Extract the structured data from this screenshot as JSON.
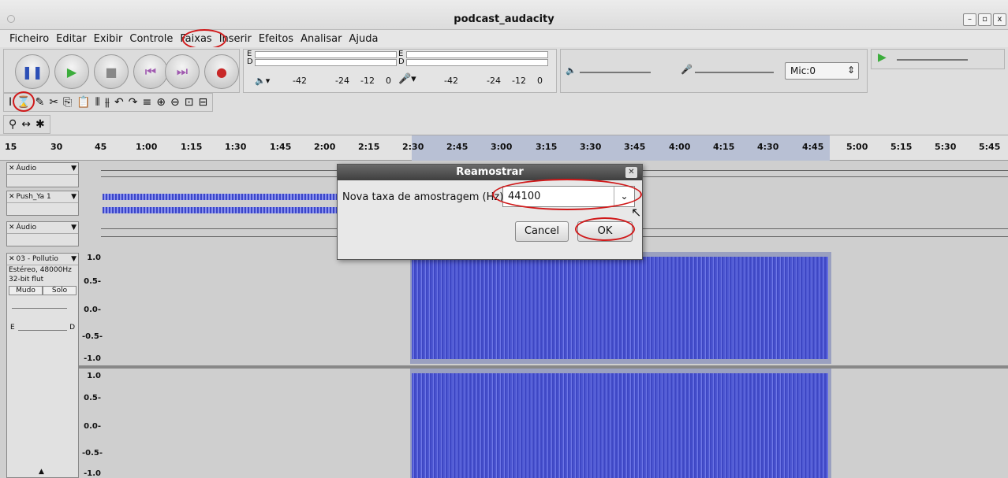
{
  "window": {
    "title": "podcast_audacity",
    "controls": [
      "–",
      "▫",
      "x"
    ]
  },
  "menu": [
    "Ficheiro",
    "Editar",
    "Exibir",
    "Controle",
    "Faixas",
    "Inserir",
    "Efeitos",
    "Analisar",
    "Ajuda"
  ],
  "meters": {
    "playback_ticks": [
      "-42",
      "-24",
      "-12",
      "0"
    ],
    "record_ticks": [
      "-42",
      "-24",
      "-12",
      "0"
    ],
    "lr_top": "E",
    "lr_bottom": "D"
  },
  "mic": {
    "label": "Mic:0"
  },
  "ruler": [
    "15",
    "30",
    "45",
    "1:00",
    "1:15",
    "1:30",
    "1:45",
    "2:00",
    "2:15",
    "2:30",
    "2:45",
    "3:00",
    "3:15",
    "3:30",
    "3:45",
    "4:00",
    "4:15",
    "4:30",
    "4:45",
    "5:00",
    "5:15",
    "5:30",
    "5:45"
  ],
  "tracks": {
    "t1": "Áudio",
    "t2": "Push_Ya 1",
    "t3": "Áudio",
    "t4": "03 - Pollutio",
    "t4_info1": "Estéreo, 48000Hz",
    "t4_info2": "32-bit flut",
    "mute": "Mudo",
    "solo": "Solo",
    "pan_left": "E",
    "pan_right": "D",
    "vlabels": [
      "1.0",
      "0.5-",
      "0.0-",
      "-0.5-",
      "-1.0"
    ]
  },
  "dialog": {
    "title": "Reamostrar",
    "label": "Nova taxa de amostragem (Hz):",
    "value": "44100",
    "cancel": "Cancel",
    "ok": "OK"
  },
  "accent": "#d0191a"
}
